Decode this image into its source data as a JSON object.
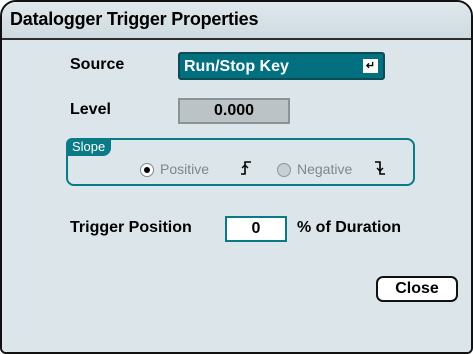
{
  "dialog": {
    "title": "Datalogger Trigger Properties"
  },
  "source": {
    "label": "Source",
    "value": "Run/Stop Key",
    "enter_key_glyph": "↵"
  },
  "level": {
    "label": "Level",
    "value": "0.000"
  },
  "slope": {
    "group_label": "Slope",
    "options": [
      {
        "label": "Positive",
        "selected": true,
        "icon": "rising-edge-icon"
      },
      {
        "label": "Negative",
        "selected": false,
        "icon": "falling-edge-icon"
      }
    ]
  },
  "trigger_position": {
    "label": "Trigger Position",
    "value": "0",
    "unit_label": "% of Duration"
  },
  "buttons": {
    "close_label": "Close"
  },
  "colors": {
    "accent": "#0a7a86",
    "dropdown_bg": "#03707f",
    "panel_bg": "#dce6ea"
  }
}
